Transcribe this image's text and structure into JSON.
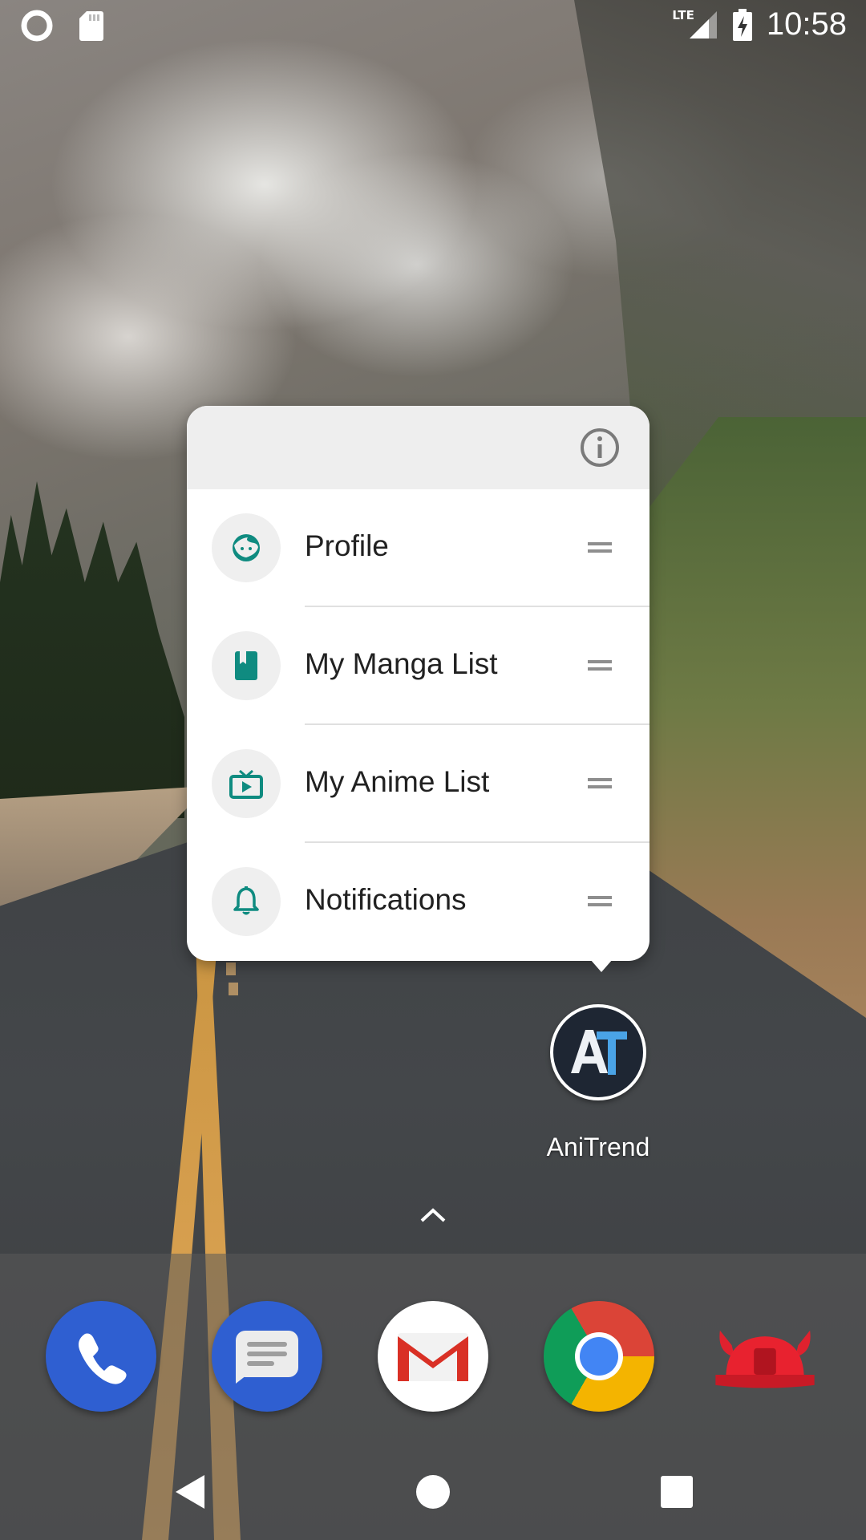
{
  "status_bar": {
    "time": "10:58",
    "network": "LTE",
    "left_icons": [
      "circle-notification-icon",
      "sd-card-icon"
    ],
    "right_icons": [
      "lte-signal-icon",
      "battery-charging-icon"
    ]
  },
  "shortcut_popup": {
    "header_icon": "info-icon",
    "items": [
      {
        "label": "Profile",
        "icon": "profile-face-icon"
      },
      {
        "label": "My Manga List",
        "icon": "book-icon"
      },
      {
        "label": "My Anime List",
        "icon": "tv-icon"
      },
      {
        "label": "Notifications",
        "icon": "bell-icon"
      }
    ],
    "accent_color": "#0f8b80"
  },
  "home": {
    "app_label": "AniTrend",
    "app_icon": "anitrend-icon",
    "app_drawer_hint": "chevron-up-icon"
  },
  "dock": {
    "apps": [
      "phone-icon",
      "messages-icon",
      "gmail-icon",
      "chrome-icon",
      "opera-max-icon"
    ]
  },
  "nav_bar": {
    "buttons": [
      "back-icon",
      "home-icon",
      "recents-icon"
    ]
  }
}
